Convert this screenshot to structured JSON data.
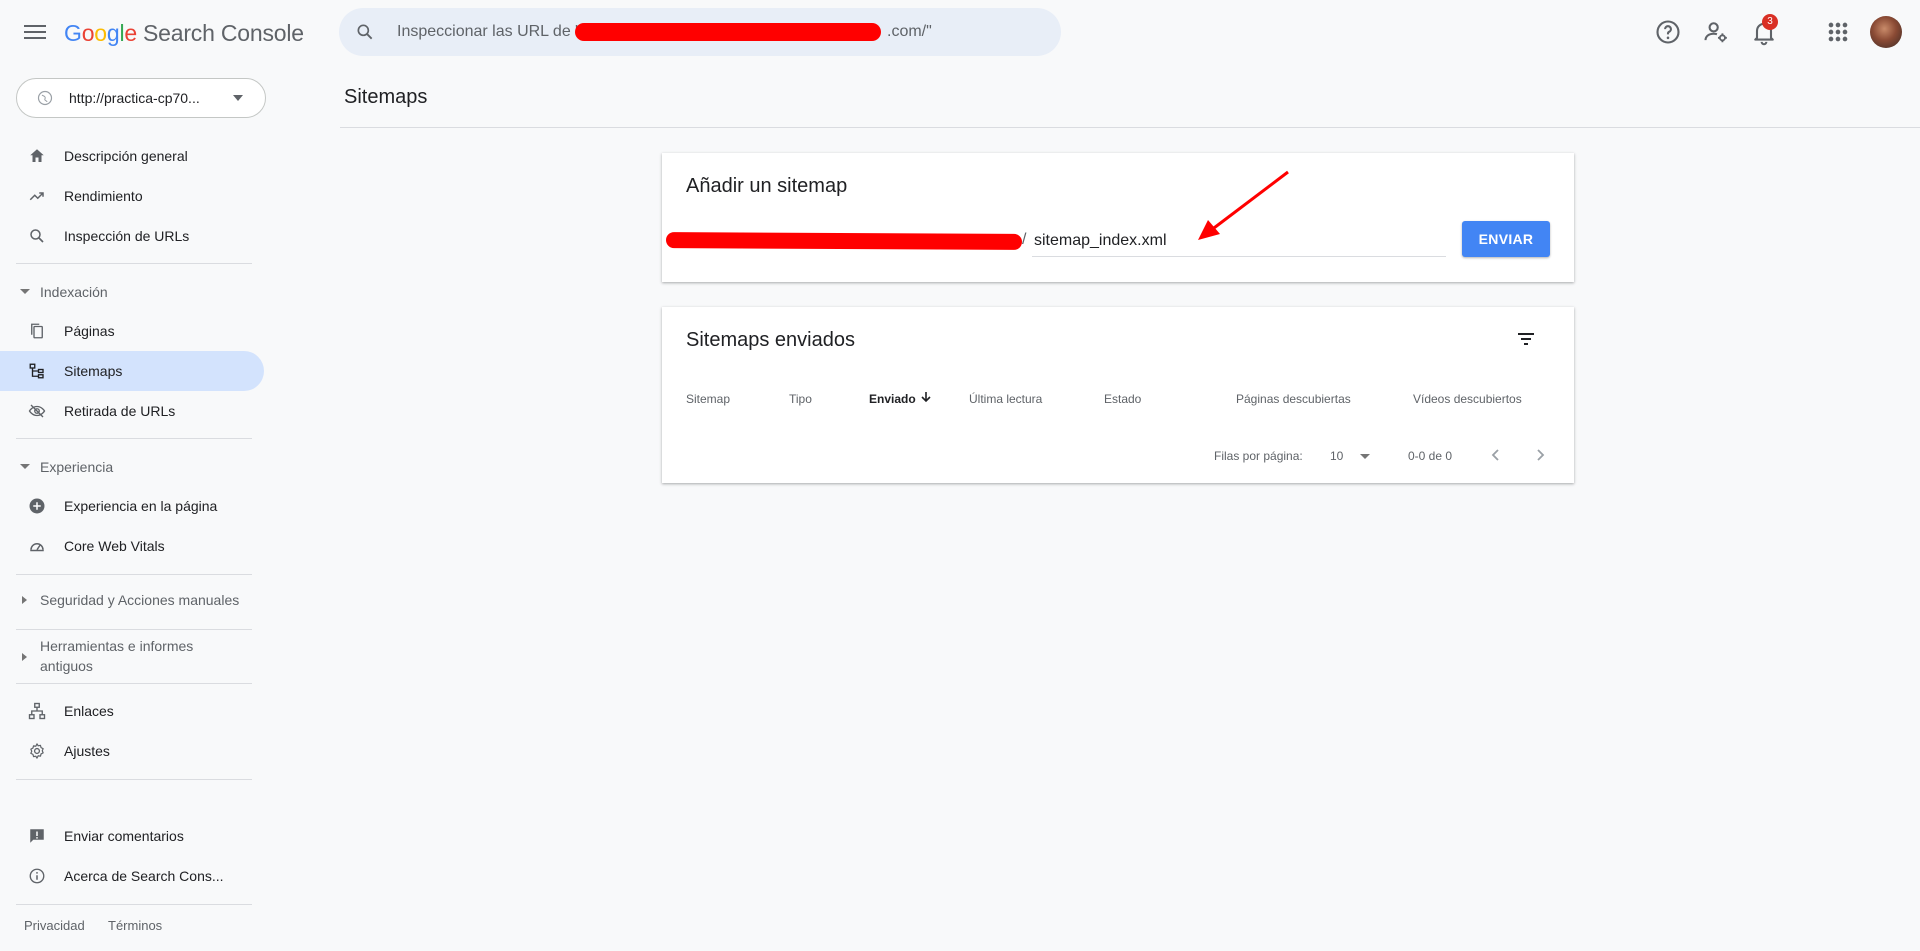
{
  "app": {
    "logo_letters": [
      "G",
      "o",
      "o",
      "g",
      "l",
      "e"
    ],
    "product": "Search Console"
  },
  "search": {
    "placeholder_prefix": "Inspeccionar las URL de \"",
    "placeholder_suffix": ".com/\""
  },
  "header": {
    "notification_count": "3"
  },
  "property": {
    "label": "http://practica-cp70..."
  },
  "sidebar": {
    "items": [
      {
        "label": "Descripción general"
      },
      {
        "label": "Rendimiento"
      },
      {
        "label": "Inspección de URLs"
      },
      {
        "label": "Páginas"
      },
      {
        "label": "Sitemaps"
      },
      {
        "label": "Retirada de URLs"
      },
      {
        "label": "Experiencia en la página"
      },
      {
        "label": "Core Web Vitals"
      },
      {
        "label": "Enlaces"
      },
      {
        "label": "Ajustes"
      },
      {
        "label": "Enviar comentarios"
      },
      {
        "label": "Acerca de Search Cons..."
      }
    ],
    "sections": [
      {
        "label": "Indexación",
        "expanded": true
      },
      {
        "label": "Experiencia",
        "expanded": true
      },
      {
        "label": "Seguridad y Acciones manuales",
        "expanded": false
      },
      {
        "label": "Herramientas e informes antiguos",
        "expanded": false
      }
    ],
    "footer": {
      "privacy": "Privacidad",
      "terms": "Términos"
    },
    "active_item": "Sitemaps"
  },
  "main": {
    "title": "Sitemaps",
    "add_card": {
      "title": "Añadir un sitemap",
      "separator": "/",
      "input_value": "sitemap_index.xml",
      "submit_label": "ENVIAR"
    },
    "sent_card": {
      "title": "Sitemaps enviados",
      "columns": [
        "Sitemap",
        "Tipo",
        "Enviado",
        "Última lectura",
        "Estado",
        "Páginas descubiertas",
        "Vídeos descubiertos"
      ],
      "sorted_column": "Enviado",
      "rows_per_page_label": "Filas por página:",
      "rows_per_page_value": "10",
      "range": "0-0 de 0"
    }
  },
  "colors": {
    "accent": "#4285f4",
    "active_nav": "#d3e3fd",
    "annotation": "#ff0000"
  }
}
